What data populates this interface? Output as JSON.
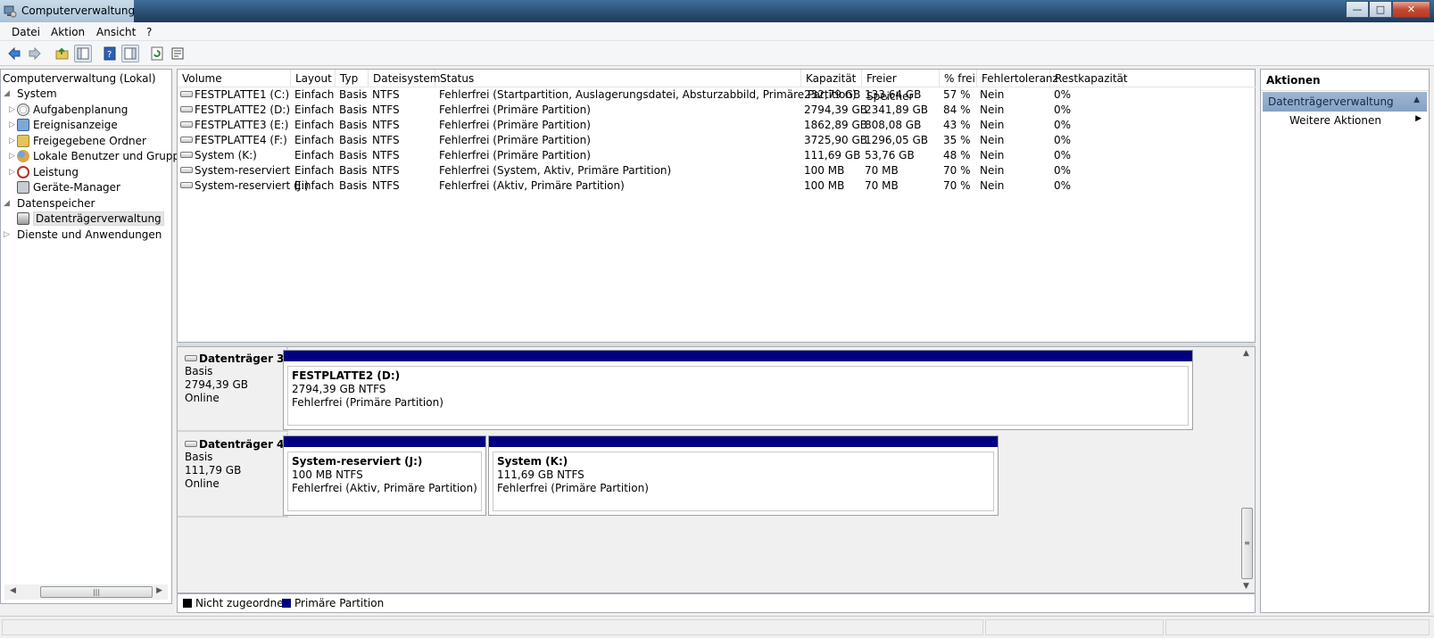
{
  "window": {
    "title": "Computerverwaltung"
  },
  "menu": [
    {
      "label": "Datei"
    },
    {
      "label": "Aktion"
    },
    {
      "label": "Ansicht"
    },
    {
      "label": "?"
    }
  ],
  "tree": {
    "root": "Computerverwaltung (Lokal)",
    "system": "System",
    "items": [
      {
        "label": "Aufgabenplanung",
        "icon": "clock-icon"
      },
      {
        "label": "Ereignisanzeige",
        "icon": "event-viewer-icon"
      },
      {
        "label": "Freigegebene Ordner",
        "icon": "shared-folder-icon"
      },
      {
        "label": "Lokale Benutzer und Gruppen",
        "icon": "users-icon"
      },
      {
        "label": "Leistung",
        "icon": "performance-icon"
      },
      {
        "label": "Geräte-Manager",
        "icon": "device-manager-icon"
      }
    ],
    "storage": "Datenspeicher",
    "disk_mgmt": "Datenträgerverwaltung",
    "services": "Dienste und Anwendungen"
  },
  "volume_table": {
    "columns": [
      "Volume",
      "Layout",
      "Typ",
      "Dateisystem",
      "Status",
      "Kapazität",
      "Freier Speicher",
      "% frei",
      "Fehlertoleranz",
      "Restkapazität"
    ],
    "rows": [
      [
        "FESTPLATTE1 (C:)",
        "Einfach",
        "Basis",
        "NTFS",
        "Fehlerfrei (Startpartition, Auslagerungsdatei, Absturzabbild, Primäre Partition)",
        "232,79 GB",
        "133,64 GB",
        "57 %",
        "Nein",
        "0%"
      ],
      [
        "FESTPLATTE2 (D:)",
        "Einfach",
        "Basis",
        "NTFS",
        "Fehlerfrei (Primäre Partition)",
        "2794,39 GB",
        "2341,89 GB",
        "84 %",
        "Nein",
        "0%"
      ],
      [
        "FESTPLATTE3 (E:)",
        "Einfach",
        "Basis",
        "NTFS",
        "Fehlerfrei (Primäre Partition)",
        "1862,89 GB",
        "808,08 GB",
        "43 %",
        "Nein",
        "0%"
      ],
      [
        "FESTPLATTE4 (F:)",
        "Einfach",
        "Basis",
        "NTFS",
        "Fehlerfrei (Primäre Partition)",
        "3725,90 GB",
        "1296,05 GB",
        "35 %",
        "Nein",
        "0%"
      ],
      [
        "System (K:)",
        "Einfach",
        "Basis",
        "NTFS",
        "Fehlerfrei (Primäre Partition)",
        "111,69 GB",
        "53,76 GB",
        "48 %",
        "Nein",
        "0%"
      ],
      [
        "System-reserviert",
        "Einfach",
        "Basis",
        "NTFS",
        "Fehlerfrei (System, Aktiv, Primäre Partition)",
        "100 MB",
        "70 MB",
        "70 %",
        "Nein",
        "0%"
      ],
      [
        "System-reserviert (J:)",
        "Einfach",
        "Basis",
        "NTFS",
        "Fehlerfrei (Aktiv, Primäre Partition)",
        "100 MB",
        "70 MB",
        "70 %",
        "Nein",
        "0%"
      ]
    ]
  },
  "disks": [
    {
      "name": "Datenträger 3",
      "type": "Basis",
      "size": "2794,39 GB",
      "state": "Online",
      "partitions": [
        {
          "name": "FESTPLATTE2  (D:)",
          "size": "2794,39 GB NTFS",
          "status": "Fehlerfrei (Primäre Partition)"
        }
      ]
    },
    {
      "name": "Datenträger 4",
      "type": "Basis",
      "size": "111,79 GB",
      "state": "Online",
      "partitions": [
        {
          "name": "System-reserviert  (J:)",
          "size": "100 MB NTFS",
          "status": "Fehlerfrei (Aktiv, Primäre Partition)"
        },
        {
          "name": "System  (K:)",
          "size": "111,69 GB NTFS",
          "status": "Fehlerfrei (Primäre Partition)"
        }
      ]
    }
  ],
  "legend": {
    "unallocated": "Nicht zugeordnet",
    "primary": "Primäre Partition",
    "unallocated_color": "#000000",
    "primary_color": "#000080"
  },
  "actions": {
    "header": "Aktionen",
    "section": "Datenträgerverwaltung",
    "more": "Weitere Aktionen"
  },
  "colors": {
    "partition_bar": "#000080",
    "actions_section": "#9fb6d2"
  }
}
